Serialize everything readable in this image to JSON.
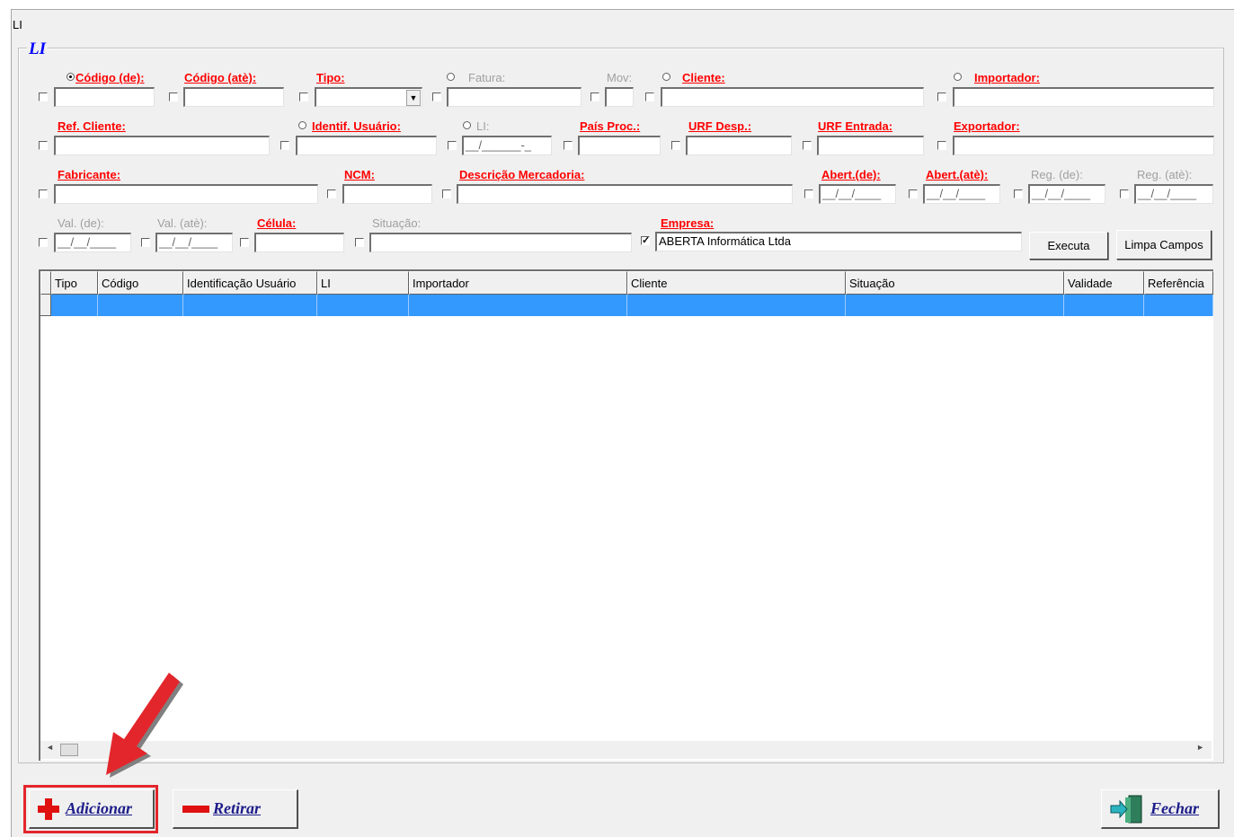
{
  "window": {
    "title": "LI"
  },
  "group": {
    "caption": "LI"
  },
  "labels": {
    "codigo_de": "Código (de):",
    "codigo_ate": "Código (atè):",
    "tipo": "Tipo:",
    "fatura": "Fatura:",
    "mov": "Mov:",
    "cliente": "Cliente:",
    "importador": "Importador:",
    "ref_cliente": "Ref. Cliente:",
    "identif_usuario": "Identif. Usuário:",
    "li": "LI:",
    "pais_proc": "País Proc.:",
    "urf_desp": "URF Desp.:",
    "urf_entrada": "URF Entrada:",
    "exportador": "Exportador:",
    "fabricante": "Fabricante:",
    "ncm": "NCM:",
    "descricao": "Descrição Mercadoria:",
    "abert_de": "Abert.(de):",
    "abert_ate": "Abert.(atè):",
    "reg_de": "Reg. (de):",
    "reg_ate": "Reg. (atè):",
    "val_de": "Val. (de):",
    "val_ate": "Val. (atè):",
    "celula": "Célula:",
    "situacao": "Situação:",
    "empresa": "Empresa:"
  },
  "values": {
    "li_mask": "__/______-_",
    "date_mask": "__/__/____",
    "empresa": "ABERTA Informática Ltda"
  },
  "buttons": {
    "executa": "Executa",
    "limpa": "Limpa Campos",
    "adicionar": "Adicionar",
    "retirar": "Retirar",
    "fechar": "Fechar"
  },
  "grid": {
    "columns": [
      "Tipo",
      "Código",
      "Identificação Usuário",
      "LI",
      "Importador",
      "Cliente",
      "Situação",
      "Validade",
      "Referência"
    ]
  },
  "colors": {
    "label_red": "#ff0000",
    "selection_blue": "#3399ff",
    "caption_blue": "#0000ff",
    "highlight_red": "#e3262b"
  }
}
